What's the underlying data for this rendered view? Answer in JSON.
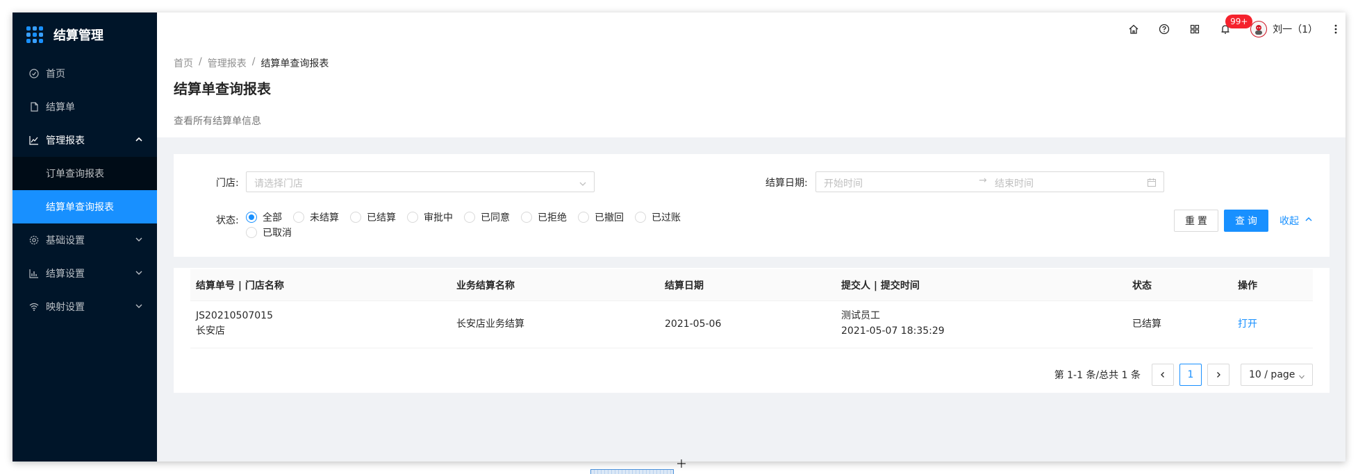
{
  "sidebar": {
    "title": "结算管理",
    "items": [
      {
        "label": "首页",
        "icon": "dashboard-icon"
      },
      {
        "label": "结算单",
        "icon": "file-icon"
      },
      {
        "label": "管理报表",
        "icon": "line-chart-icon"
      },
      {
        "label": "基础设置",
        "icon": "gear-icon"
      },
      {
        "label": "结算设置",
        "icon": "bar-chart-icon"
      },
      {
        "label": "映射设置",
        "icon": "wifi-icon"
      }
    ],
    "submenu": [
      {
        "label": "订单查询报表"
      },
      {
        "label": "结算单查询报表"
      }
    ]
  },
  "header": {
    "badge": "99+",
    "user_name": "刘一（1）"
  },
  "breadcrumb": [
    "首页",
    "管理报表",
    "结算单查询报表"
  ],
  "page": {
    "title": "结算单查询报表",
    "description": "查看所有结算单信息"
  },
  "filter": {
    "store_label": "门店:",
    "store_placeholder": "请选择门店",
    "date_label": "结算日期:",
    "date_start_placeholder": "开始时间",
    "date_end_placeholder": "结束时间",
    "status_label": "状态:",
    "statuses": [
      "全部",
      "未结算",
      "已结算",
      "审批中",
      "已同意",
      "已拒绝",
      "已撤回",
      "已过账",
      "已取消"
    ],
    "selected_status": "全部",
    "reset_label": "重 置",
    "query_label": "查 询",
    "collapse_label": "收起"
  },
  "table": {
    "columns": [
      "结算单号 | 门店名称",
      "业务结算名称",
      "结算日期",
      "提交人 | 提交时间",
      "状态",
      "操作"
    ],
    "rows": [
      {
        "code": "JS20210507015",
        "store": "长安店",
        "name": "长安店业务结算",
        "date": "2021-05-06",
        "submitter": "测试员工",
        "submit_time": "2021-05-07 18:35:29",
        "status": "已结算",
        "action": "打开"
      }
    ]
  },
  "pagination": {
    "total_text": "第 1-1 条/总共 1 条",
    "current_page": "1",
    "page_size": "10 / page"
  },
  "colors": {
    "primary": "#1890ff",
    "sidebar_bg": "#001529",
    "badge": "#f5222d"
  }
}
